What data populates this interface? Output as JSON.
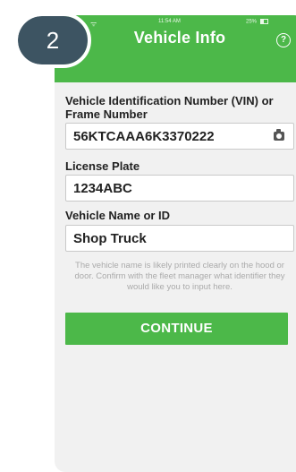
{
  "step_badge": "2",
  "status_bar": {
    "time": "11:54 AM",
    "battery": "25%"
  },
  "header": {
    "title": "Vehicle Info",
    "help_icon": "help-icon"
  },
  "vin": {
    "label": "Vehicle Identification Number (VIN) or Frame Number",
    "value": "56KTCAAA6K3370222",
    "camera_icon": "camera-icon"
  },
  "plate": {
    "label": "License Plate",
    "value": "1234ABC"
  },
  "vehicle_name": {
    "label": "Vehicle Name or ID",
    "value": "Shop Truck"
  },
  "hint": "The vehicle name is likely printed clearly on the hood or door. Confirm with the fleet manager what identifier they would like you to input here.",
  "continue_label": "CONTINUE",
  "colors": {
    "accent": "#4cb849",
    "badge": "#3d5462"
  }
}
